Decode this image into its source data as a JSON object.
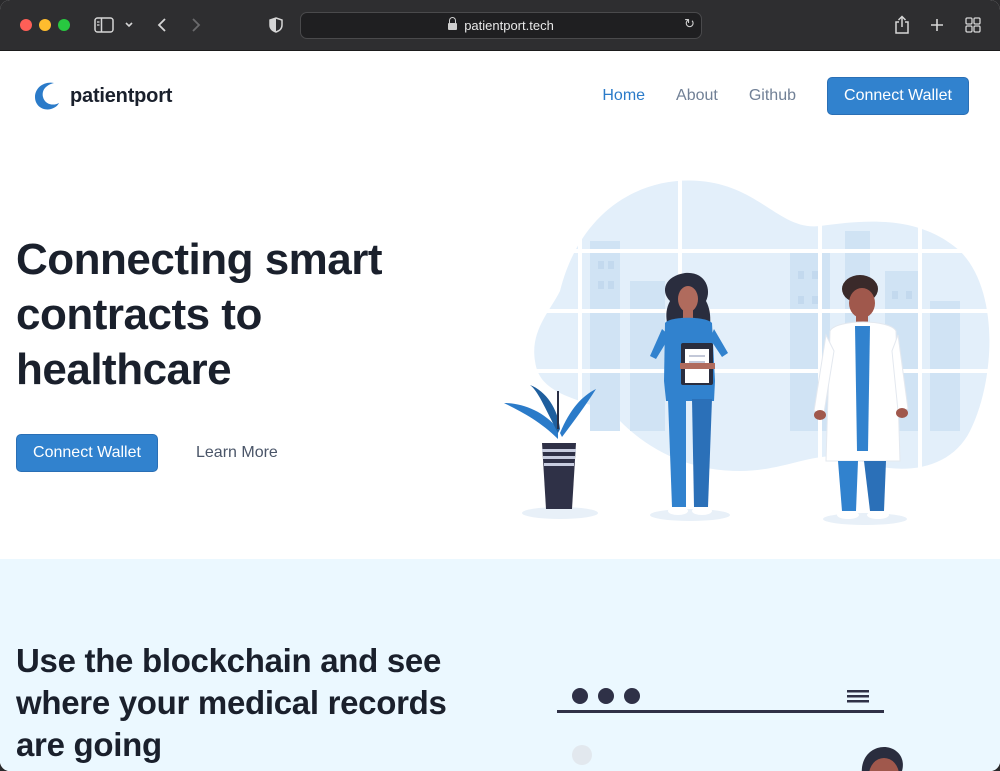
{
  "browser": {
    "url": "patientport.tech"
  },
  "site": {
    "logo_text": "patientport",
    "nav": {
      "home": "Home",
      "about": "About",
      "github": "Github",
      "connect": "Connect Wallet"
    },
    "hero": {
      "title_line1": "Connecting smart",
      "title_line2": "contracts to",
      "title_line3": "healthcare",
      "primary_button": "Connect Wallet",
      "secondary_link": "Learn More"
    },
    "section2": {
      "title_line1": "Use the blockchain and see",
      "title_line2": "where your medical records",
      "title_line3": "are going"
    }
  },
  "colors": {
    "accent": "#3182ce",
    "section_bg": "#ebf8ff",
    "heading": "#1a202c"
  },
  "icons": {
    "sidebar": "sidebar-icon",
    "back": "chevron-left-icon",
    "forward": "chevron-right-icon",
    "privacy": "shield-icon",
    "lock": "lock-icon",
    "reload": "reload-icon",
    "share": "share-icon",
    "new_tab": "plus-icon",
    "tabs": "tab-grid-icon"
  }
}
